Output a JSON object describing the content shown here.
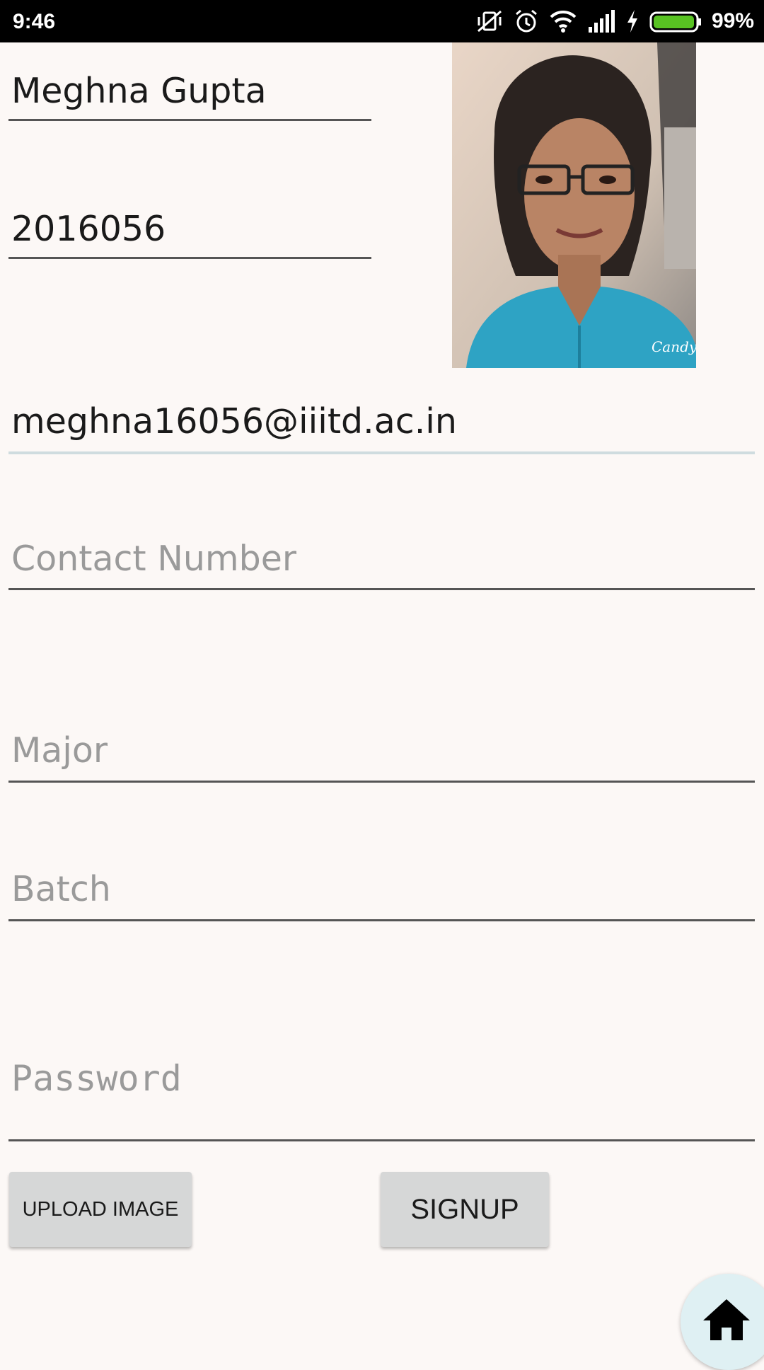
{
  "status_bar": {
    "time": "9:46",
    "battery_percent": "99%",
    "battery_level": 0.99,
    "icons": [
      "vibrate-off-icon",
      "alarm-icon",
      "wifi-icon",
      "signal-icon",
      "charging-icon",
      "battery-icon"
    ]
  },
  "form": {
    "name_value": "Meghna Gupta",
    "roll_value": "2016056",
    "email_value": "meghna16056@iiitd.ac.in",
    "contact_placeholder": "Contact Number",
    "major_placeholder": "Major",
    "batch_placeholder": "Batch",
    "password_placeholder": "Password"
  },
  "profile_photo": {
    "watermark": "Candy"
  },
  "buttons": {
    "upload_label": "UPLOAD IMAGE",
    "signup_label": "SIGNUP"
  },
  "fab": {
    "icon": "home-icon"
  },
  "colors": {
    "background": "#fcf8f6",
    "button": "#d6d7d7",
    "battery": "#58c322",
    "fab": "#dff0f3"
  }
}
